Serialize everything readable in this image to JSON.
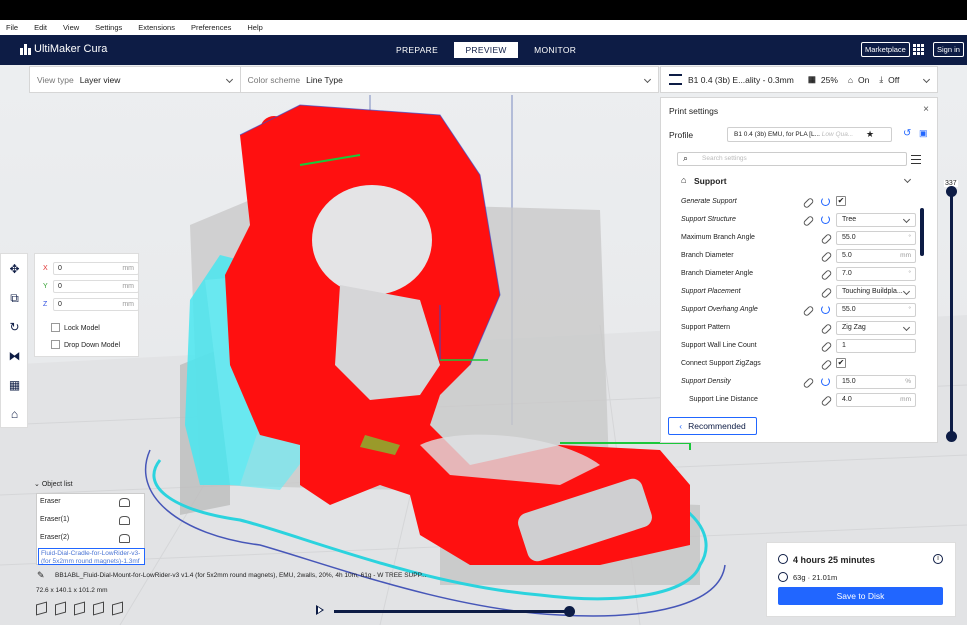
{
  "menu": [
    "File",
    "Edit",
    "View",
    "Settings",
    "Extensions",
    "Preferences",
    "Help"
  ],
  "header": {
    "app_name": "UltiMaker Cura",
    "stages": [
      "PREPARE",
      "PREVIEW",
      "MONITOR"
    ],
    "active_stage": "PREVIEW",
    "marketplace": "Marketplace",
    "sign_in": "Sign in"
  },
  "toolbar": {
    "view_type_label": "View type",
    "view_type_value": "Layer view",
    "color_scheme_label": "Color scheme",
    "color_scheme_value": "Line Type"
  },
  "print_bar": {
    "profile_summary": "B1 0.4 (3b) E...ality - 0.3mm",
    "infill": "25%",
    "support": "On",
    "adhesion": "Off"
  },
  "print_settings": {
    "title": "Print settings",
    "profile_label": "Profile",
    "profile_value": "B1 0.4 (3b) EMU, for PLA [L...",
    "profile_quality": "Low Qua...",
    "search_placeholder": "Search settings",
    "section": "Support",
    "rows": [
      {
        "name": "Generate Support",
        "value": "✔",
        "type": "check",
        "italic": true
      },
      {
        "name": "Support Structure",
        "value": "Tree",
        "type": "select",
        "italic": true
      },
      {
        "name": "Maximum Branch Angle",
        "value": "55.0",
        "unit": "°",
        "type": "field"
      },
      {
        "name": "Branch Diameter",
        "value": "5.0",
        "unit": "mm",
        "type": "field"
      },
      {
        "name": "Branch Diameter Angle",
        "value": "7.0",
        "unit": "°",
        "type": "field"
      },
      {
        "name": "Support Placement",
        "value": "Touching Buildpla...",
        "type": "select",
        "italic": true
      },
      {
        "name": "Support Overhang Angle",
        "value": "55.0",
        "unit": "°",
        "type": "field",
        "italic": true
      },
      {
        "name": "Support Pattern",
        "value": "Zig Zag",
        "type": "select"
      },
      {
        "name": "Support Wall Line Count",
        "value": "1",
        "type": "field"
      },
      {
        "name": "Connect Support ZigZags",
        "value": "✔",
        "type": "check"
      },
      {
        "name": "Support Density",
        "value": "15.0",
        "unit": "%",
        "type": "field",
        "italic": true
      },
      {
        "name": "Support Line Distance",
        "value": "4.0",
        "unit": "mm",
        "type": "field"
      }
    ],
    "recommended": "Recommended"
  },
  "move_panel": {
    "x": "0",
    "y": "0",
    "z": "0",
    "unit": "mm",
    "lock_model": "Lock Model",
    "drop_down_model": "Drop Down Model"
  },
  "object_list": {
    "title": "Object list",
    "items": [
      "Eraser",
      "Eraser(1)",
      "Eraser(2)"
    ],
    "selected": "Fluid-Dial-Cradle-for-LowRider-v3-(for 5x2mm round magnets)-1.3mf"
  },
  "object_info": {
    "name": "BB1ABL_Fluid-Dial-Mount-for-LowRider-v3 v1.4 (for 5x2mm round magnets), EMU, 2walls, 20%, 4h 10m, 61g - W TREE SUPP...",
    "dimensions": "72.6 x 140.1 x 101.2 mm"
  },
  "layer_slider": {
    "max_layer": "337"
  },
  "estimate": {
    "time": "4 hours 25 minutes",
    "material": "63g · 21.01m",
    "save": "Save to Disk"
  },
  "colors": {
    "navy": "#0d1c45",
    "accent": "#2166ff",
    "model_red": "#ff1010",
    "support_cyan": "#49e6f0"
  }
}
